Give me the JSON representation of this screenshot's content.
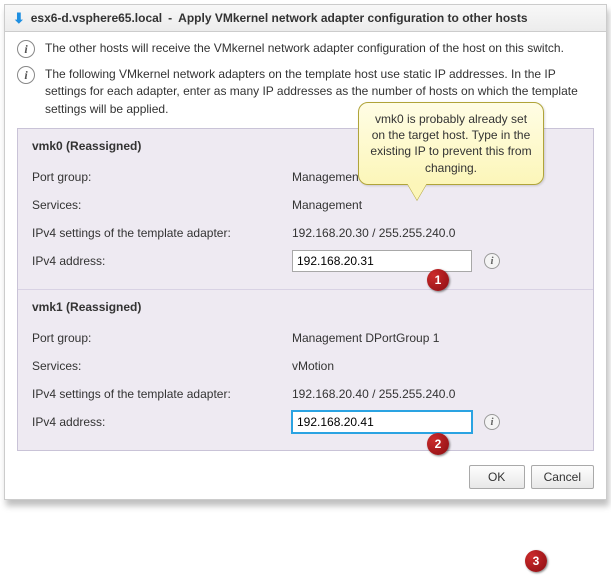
{
  "title_host": "esx6-d.vsphere65.local",
  "title_action": "Apply VMkernel network adapter configuration to other hosts",
  "info1": "The other hosts will receive the VMkernel network adapter configuration of the host on this switch.",
  "info2": "The following VMkernel network adapters on the template host use static IP addresses. In the IP settings for each adapter, enter as many IP addresses as the number of hosts on which the template settings will be applied.",
  "labels": {
    "port_group": "Port group:",
    "services": "Services:",
    "template_ipv4": "IPv4 settings of the template adapter:",
    "ipv4_address": "IPv4 address:"
  },
  "adapters": [
    {
      "name": "vmk0 (Reassigned)",
      "port_group": "Management DPortGroup 1",
      "services": "Management",
      "template_ipv4": "192.168.20.30 / 255.255.240.0",
      "ipv4_value": "192.168.20.31",
      "focused": false
    },
    {
      "name": "vmk1 (Reassigned)",
      "port_group": "Management DPortGroup 1",
      "services": "vMotion",
      "template_ipv4": "192.168.20.40 / 255.255.240.0",
      "ipv4_value": "192.168.20.41",
      "focused": true
    }
  ],
  "callout_text": "vmk0 is probably already set on the target host. Type in the existing IP to prevent this from changing.",
  "badges": {
    "b1": "1",
    "b2": "2",
    "b3": "3"
  },
  "buttons": {
    "ok": "OK",
    "cancel": "Cancel"
  }
}
